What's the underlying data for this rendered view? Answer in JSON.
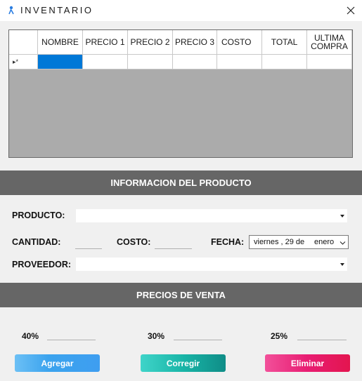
{
  "window": {
    "title": "INVENTARIO"
  },
  "grid": {
    "row_marker": "▸*",
    "columns": [
      "NOMBRE",
      "PRECIO 1",
      "PRECIO 2",
      "PRECIO 3",
      "COSTO",
      "TOTAL",
      "ULTIMA COMPRA"
    ]
  },
  "sections": {
    "product_info": "INFORMACION DEL PRODUCTO",
    "sale_prices": "PRECIOS DE VENTA"
  },
  "form": {
    "producto_label": "PRODUCTO:",
    "producto_value": "",
    "cantidad_label": "CANTIDAD:",
    "cantidad_value": "",
    "costo_label": "COSTO:",
    "costo_value": "",
    "fecha_label": "FECHA:",
    "fecha_day": "viernes  , 29 de",
    "fecha_month": "enero",
    "proveedor_label": "PROVEEDOR:",
    "proveedor_value": ""
  },
  "prices": {
    "p1_label": "40%",
    "p2_label": "30%",
    "p3_label": "25%"
  },
  "buttons": {
    "add": "Agregar",
    "edit": "Corregir",
    "delete": "Eliminar"
  }
}
